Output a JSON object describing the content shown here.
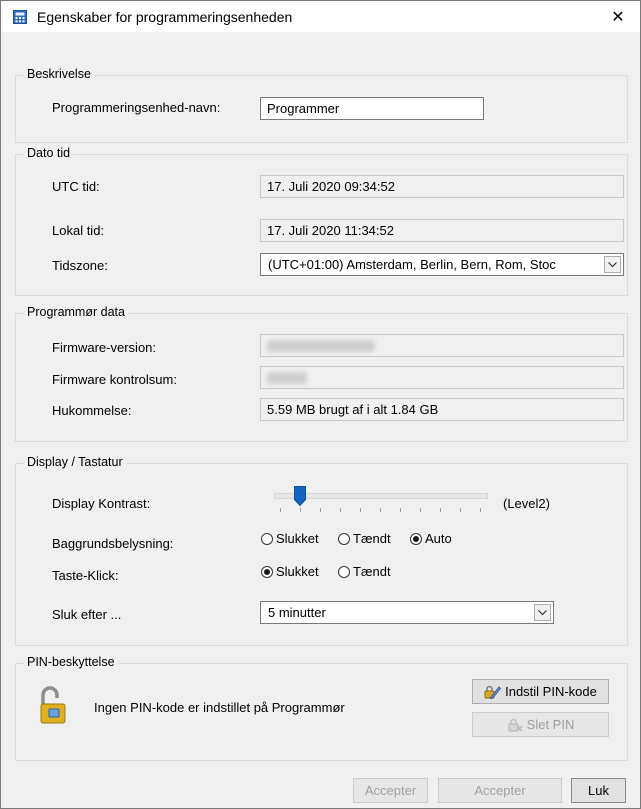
{
  "window": {
    "title": "Egenskaber for programmeringsenheden",
    "close_glyph": "✕"
  },
  "beskrivelse": {
    "legend": "Beskrivelse",
    "name_label": "Programmeringsenhed-navn:",
    "name_value": "Programmer"
  },
  "dato_tid": {
    "legend": "Dato tid",
    "utc_label": "UTC tid:",
    "utc_value": "17. Juli 2020 09:34:52",
    "lokal_label": "Lokal tid:",
    "lokal_value": "17. Juli 2020 11:34:52",
    "tz_label": "Tidszone:",
    "tz_value": "(UTC+01:00) Amsterdam, Berlin, Bern, Rom, Stoc"
  },
  "programmor": {
    "legend": "Programmør data",
    "fw_label": "Firmware-version:",
    "cs_label": "Firmware kontrolsum:",
    "mem_label": "Hukommelse:",
    "mem_value": "5.59 MB brugt af i alt 1.84 GB"
  },
  "display": {
    "legend": "Display / Tastatur",
    "kontrast_label": "Display Kontrast:",
    "kontrast_level_text": "(Level2)",
    "kontrast_fraction": 0.1,
    "bagg_label": "Baggrundsbelysning:",
    "bagg_options": [
      "Slukket",
      "Tændt",
      "Auto"
    ],
    "bagg_selected": "Auto",
    "taste_label": "Taste-Klick:",
    "taste_options": [
      "Slukket",
      "Tændt"
    ],
    "taste_selected": "Slukket",
    "sluk_label": "Sluk efter ...",
    "sluk_value": "5 minutter"
  },
  "pin": {
    "legend": "PIN-beskyttelse",
    "status_text": "Ingen PIN-kode er indstillet på Programmør",
    "set_button": "Indstil PIN-kode",
    "delete_button": "Slet PIN"
  },
  "footer": {
    "accept1": "Accepter",
    "accept2": "Accepter",
    "close": "Luk"
  },
  "colors": {
    "accent": "#0a64d6",
    "slider_thumb": "#1565c0"
  }
}
